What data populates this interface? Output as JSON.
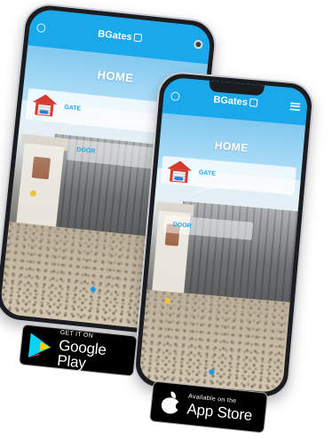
{
  "app": {
    "brand": "BGates",
    "page_title": "HOME",
    "devices": [
      "GATE",
      "DOOR"
    ]
  },
  "badges": {
    "google_small": "GET IT ON",
    "google_big": "Google Play",
    "apple_small": "Available on the",
    "apple_big": "App Store"
  },
  "colors": {
    "header": "#19a8ea",
    "accent_text": "#19a8ea",
    "garage_red": "#d63a2f"
  },
  "icons": [
    "settings-icon",
    "menu-icon",
    "garage-icon",
    "google-play-icon",
    "apple-icon"
  ]
}
